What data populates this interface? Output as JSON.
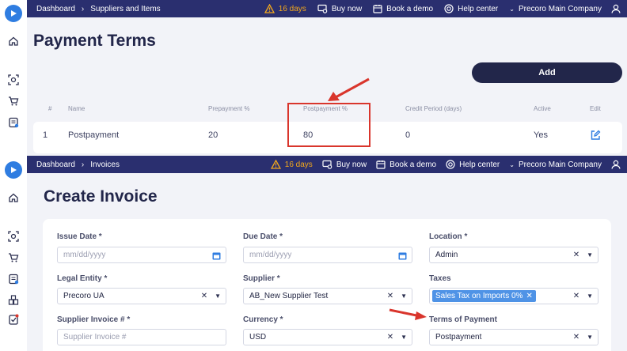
{
  "top": {
    "breadcrumb": [
      "Dashboard",
      "Suppliers and Items"
    ],
    "trial_days": "16 days",
    "buy_now": "Buy now",
    "book_demo": "Book a demo",
    "help_center": "Help center",
    "company": "Precoro Main Company",
    "title": "Payment Terms",
    "add_label": "Add",
    "columns": [
      "#",
      "Name",
      "Prepayment %",
      "Postpayment %",
      "Credit Period (days)",
      "Active",
      "Edit"
    ],
    "row": {
      "num": "1",
      "name": "Postpayment",
      "prepayment": "20",
      "postpayment": "80",
      "credit_period": "0",
      "active": "Yes"
    }
  },
  "bottom": {
    "breadcrumb": [
      "Dashboard",
      "Invoices"
    ],
    "trial_days": "16 days",
    "buy_now": "Buy now",
    "book_demo": "Book a demo",
    "help_center": "Help center",
    "company": "Precoro Main Company",
    "title": "Create Invoice",
    "fields": {
      "issue_date": {
        "label": "Issue Date *",
        "placeholder": "mm/dd/yyyy"
      },
      "due_date": {
        "label": "Due Date *",
        "placeholder": "mm/dd/yyyy"
      },
      "location": {
        "label": "Location *",
        "value": "Admin"
      },
      "legal_entity": {
        "label": "Legal Entity *",
        "value": "Precoro UA"
      },
      "supplier": {
        "label": "Supplier *",
        "value": "AB_New Supplier Test"
      },
      "taxes": {
        "label": "Taxes",
        "chip": "Sales Tax on Imports 0%"
      },
      "supplier_invoice": {
        "label": "Supplier Invoice # *",
        "placeholder": "Supplier Invoice #"
      },
      "currency": {
        "label": "Currency *",
        "value": "USD"
      },
      "terms": {
        "label": "Terms of Payment",
        "value": "Postpayment"
      }
    }
  },
  "colors": {
    "nav": "#2a2f6f",
    "accent": "#2f7de1",
    "highlight": "#d9352c",
    "chip": "#4f93e6"
  }
}
